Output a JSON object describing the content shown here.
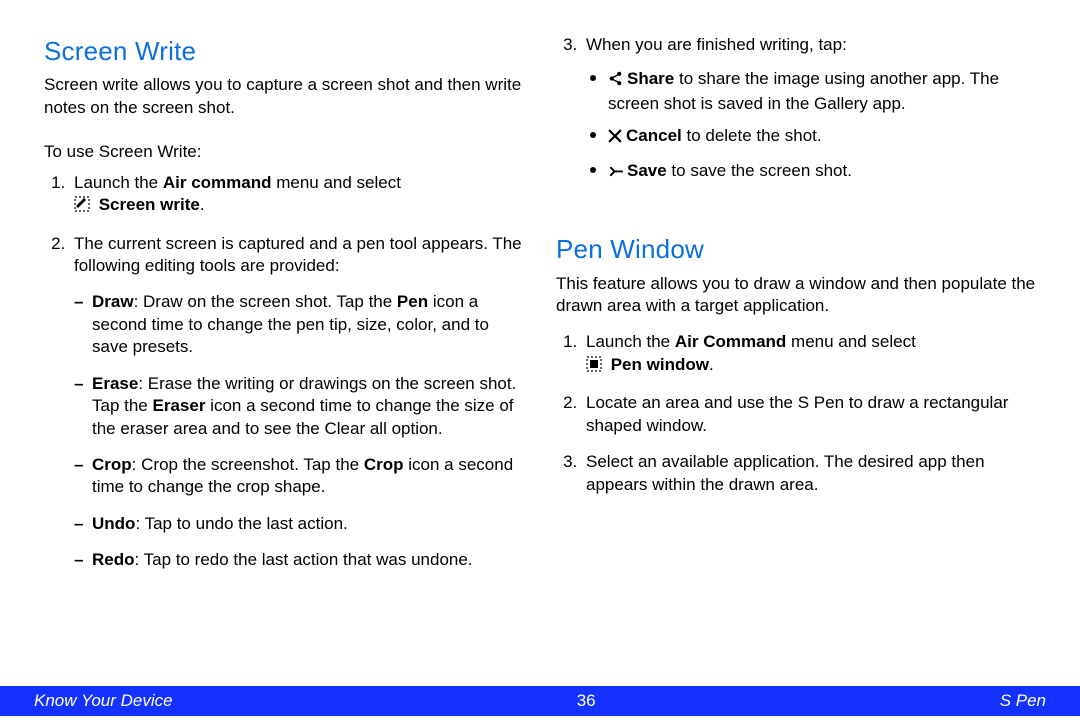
{
  "left": {
    "heading": "Screen Write",
    "intro": "Screen write allows you to capture a screen shot and then write notes on the screen shot.",
    "to_use": "To use Screen Write:",
    "step1_pre": "Launch the ",
    "step1_bold": "Air command",
    "step1_post": " menu and select",
    "step1_icon_label": " Screen write",
    "step2": "The current screen is captured and a pen tool appears. The following editing tools are provided:",
    "tools": {
      "draw": {
        "t": "Draw",
        "pre": "Draw on the screen shot. Tap the ",
        "b": "Pen",
        "post": " icon a second time to change the pen tip, size, color, and to save presets."
      },
      "erase": {
        "t": "Erase",
        "pre": "Erase the writing or drawings on the screen shot. Tap the ",
        "b": "Eraser",
        "post": " icon a second time to change the size of the eraser area and to see the Clear all option."
      },
      "crop": {
        "t": "Crop",
        "pre": "Crop the screenshot. Tap the ",
        "b": "Crop",
        "post": " icon a second time to change the crop shape."
      },
      "undo": {
        "t": "Undo",
        "pre": "Tap to undo the last action."
      },
      "redo": {
        "t": "Redo",
        "pre": "Tap to redo the last action that was undone."
      }
    }
  },
  "right": {
    "step3": "When you are finished writing, tap:",
    "finish": {
      "share": {
        "t": "Share",
        "post": " to share the image using another app. The screen shot is saved in the Gallery app."
      },
      "cancel": {
        "t": "Cancel",
        "post": " to delete the shot."
      },
      "save": {
        "t": "Save",
        "post": " to save the screen shot."
      }
    },
    "heading": "Pen Window",
    "intro": "This feature allows you to draw a window and then populate the drawn area with a target application.",
    "step1_pre": "Launch the ",
    "step1_bold": "Air Command",
    "step1_post": " menu and select",
    "step1_icon_label": " Pen window",
    "step2": "Locate an area and use the S Pen to draw a rectangular shaped window.",
    "step3b": "Select an available application. The desired app then appears within the drawn area."
  },
  "footer": {
    "left": "Know Your Device",
    "page": "36",
    "right": "S Pen"
  }
}
